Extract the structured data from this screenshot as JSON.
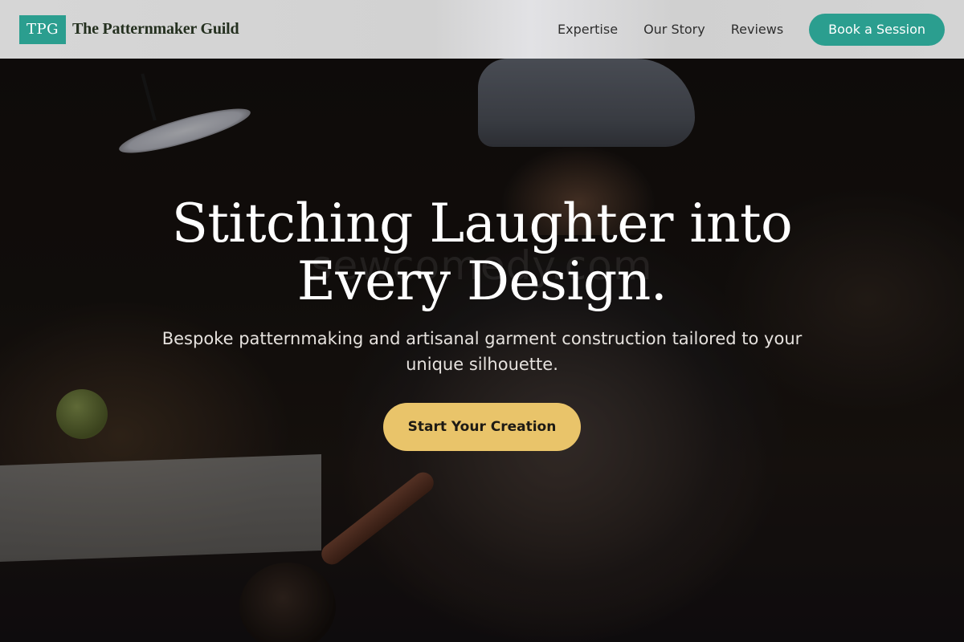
{
  "header": {
    "logo_text": "TPG",
    "brand_name": "The Patternmaker Guild",
    "nav": [
      {
        "label": "Expertise"
      },
      {
        "label": "Our Story"
      },
      {
        "label": "Reviews"
      }
    ],
    "cta_label": "Book a Session"
  },
  "hero": {
    "title_line1": "Stitching Laughter into",
    "title_line2": "Every Design.",
    "subtitle": "Bespoke patternmaking and artisanal garment construction tailored to your unique silhouette.",
    "cta_label": "Start Your Creation",
    "watermark": "sewcomedy.com"
  },
  "colors": {
    "accent": "#2b9e8f",
    "cta_yellow": "#e9c46a",
    "header_bg": "#d4d4d4",
    "brand_text": "#24301f"
  }
}
